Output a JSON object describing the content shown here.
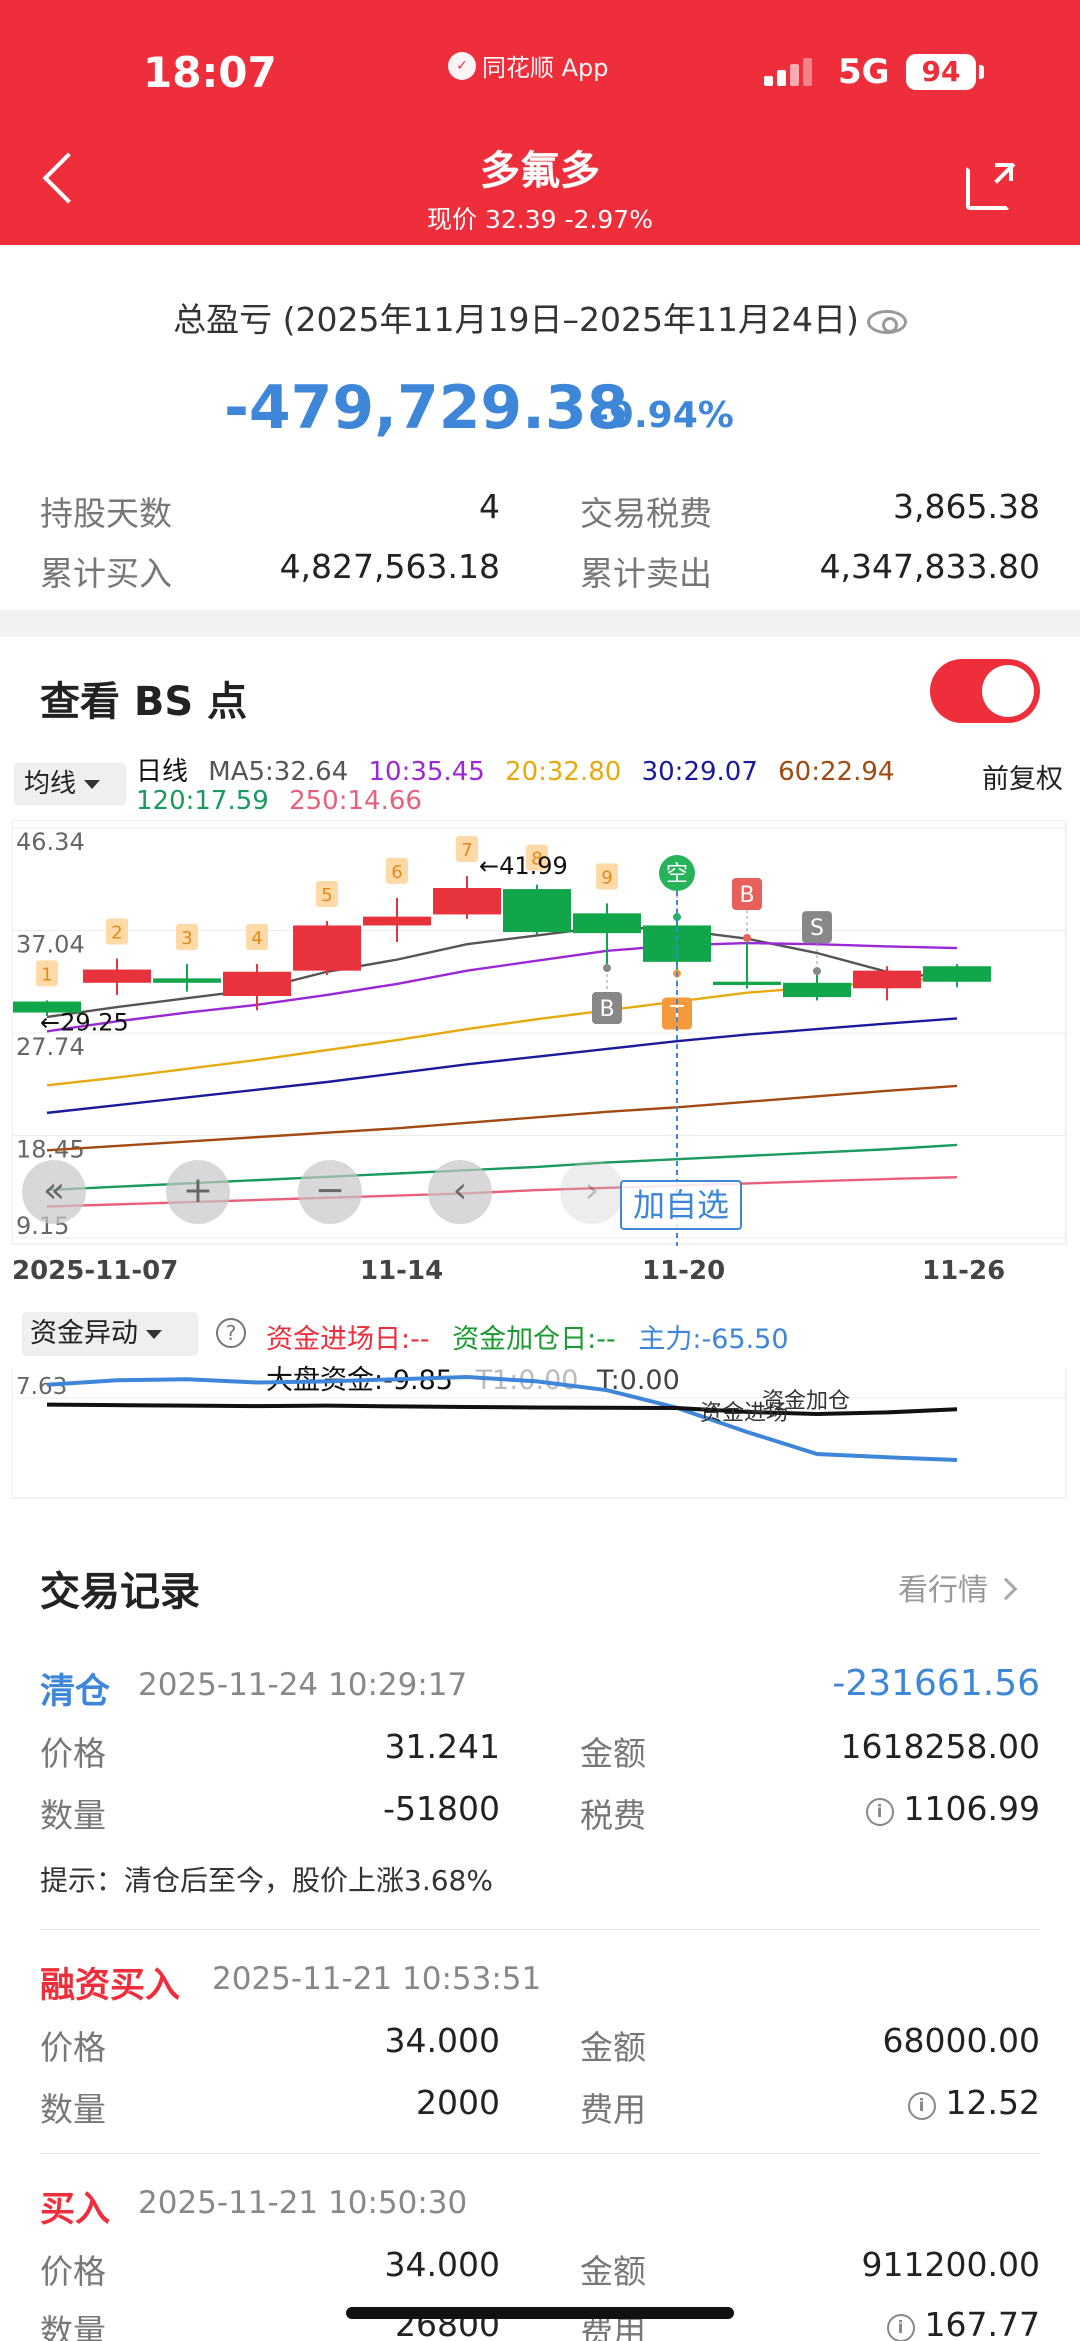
{
  "status": {
    "time": "18:07",
    "app": "同花顺 App",
    "network": "5G",
    "battery": "94"
  },
  "nav": {
    "title": "多氟多",
    "subtitle": "现价 32.39 -2.97%"
  },
  "summary": {
    "title": "总盈亏 (2025年11月19日–2025年11月24日)",
    "amount": "-479,729.38",
    "percent": "-9.94%",
    "stats": [
      {
        "label": "持股天数",
        "value": "4"
      },
      {
        "label": "交易税费",
        "value": "3,865.38"
      },
      {
        "label": "累计买入",
        "value": "4,827,563.18"
      },
      {
        "label": "累计卖出",
        "value": "4,347,833.80"
      }
    ]
  },
  "bs": {
    "title": "查看 BS 点",
    "toggle_on": true
  },
  "chart_data": {
    "type": "candlestick",
    "ma_select": "均线",
    "period": "日线",
    "adjust": "前复权",
    "ma_legend": [
      {
        "text": "MA5:32.64",
        "color": "#555555"
      },
      {
        "text": "10:35.45",
        "color": "#9b27d6"
      },
      {
        "text": "20:32.80",
        "color": "#e8a90f"
      },
      {
        "text": "30:29.07",
        "color": "#1a1a9c"
      },
      {
        "text": "60:22.94",
        "color": "#a14a12"
      },
      {
        "text": "120:17.59",
        "color": "#1a9a60"
      },
      {
        "text": "250:14.66",
        "color": "#e8607c"
      }
    ],
    "y_ticks": [
      "46.34",
      "37.04",
      "27.74",
      "18.45",
      "9.15"
    ],
    "ylim": [
      9.15,
      46.34
    ],
    "x_ticks": [
      "2025-11-07",
      "11-14",
      "11-20",
      "11-26"
    ],
    "max_label": "41.99",
    "min_label": "29.25",
    "candles": [
      {
        "o": 30.6,
        "c": 29.6,
        "h": 30.7,
        "l": 29.3,
        "n": "1"
      },
      {
        "o": 32.3,
        "c": 33.5,
        "h": 34.5,
        "l": 31.2,
        "n": "2"
      },
      {
        "o": 32.7,
        "c": 32.3,
        "h": 34.0,
        "l": 31.5,
        "n": "3"
      },
      {
        "o": 31.1,
        "c": 33.3,
        "h": 34.0,
        "l": 29.8,
        "n": "4"
      },
      {
        "o": 33.4,
        "c": 37.5,
        "h": 37.9,
        "l": 33.0,
        "n": "5"
      },
      {
        "o": 37.5,
        "c": 38.3,
        "h": 40.0,
        "l": 36.0,
        "n": "6"
      },
      {
        "o": 38.5,
        "c": 40.9,
        "h": 41.99,
        "l": 38.1,
        "n": "7"
      },
      {
        "o": 40.8,
        "c": 36.9,
        "h": 41.2,
        "l": 36.7,
        "n": "8"
      },
      {
        "o": 38.6,
        "c": 36.8,
        "h": 39.5,
        "l": 34.0,
        "n": "9"
      },
      {
        "o": 37.5,
        "c": 34.2,
        "h": 37.9,
        "l": 33.5,
        "n": ""
      },
      {
        "o": 32.4,
        "c": 32.1,
        "h": 36.0,
        "l": 31.8,
        "n": ""
      },
      {
        "o": 32.3,
        "c": 31.0,
        "h": 33.0,
        "l": 30.7,
        "n": ""
      },
      {
        "o": 31.8,
        "c": 33.4,
        "h": 33.8,
        "l": 30.7,
        "n": ""
      },
      {
        "o": 33.8,
        "c": 32.39,
        "h": 34.0,
        "l": 31.9,
        "n": ""
      }
    ],
    "signals": [
      {
        "i": 8,
        "label": "B",
        "pos": "below"
      },
      {
        "i": 9,
        "label": "空",
        "pos": "above"
      },
      {
        "i": 9,
        "label": "T",
        "pos": "below"
      },
      {
        "i": 10,
        "label": "B",
        "pos": "above"
      },
      {
        "i": 11,
        "label": "S",
        "pos": "above"
      }
    ],
    "ma_lines": [
      {
        "name": "MA5",
        "color": "#555555",
        "values": [
          29.2,
          30.1,
          30.9,
          31.7,
          33.3,
          34.4,
          35.8,
          36.6,
          37.4,
          37.1,
          36.3,
          35.0,
          33.3,
          32.64
        ]
      },
      {
        "name": "10",
        "color": "#9b27d6",
        "values": [
          27.9,
          28.8,
          29.6,
          30.3,
          31.2,
          32.2,
          33.4,
          34.3,
          35.2,
          35.7,
          35.9,
          35.8,
          35.6,
          35.45
        ]
      },
      {
        "name": "20",
        "color": "#e8a90f",
        "values": [
          23.0,
          23.7,
          24.5,
          25.3,
          26.2,
          27.1,
          28.1,
          29.0,
          29.8,
          30.6,
          31.4,
          31.9,
          32.4,
          32.8
        ]
      },
      {
        "name": "30",
        "color": "#1a1a9c",
        "values": [
          20.5,
          21.2,
          21.9,
          22.6,
          23.3,
          24.1,
          24.9,
          25.6,
          26.3,
          27.0,
          27.6,
          28.1,
          28.6,
          29.07
        ]
      },
      {
        "name": "60",
        "color": "#a14a12",
        "values": [
          17.1,
          17.5,
          17.9,
          18.3,
          18.7,
          19.1,
          19.6,
          20.1,
          20.6,
          21.0,
          21.5,
          22.0,
          22.5,
          22.94
        ]
      },
      {
        "name": "120",
        "color": "#1a9a60",
        "values": [
          13.5,
          13.8,
          14.1,
          14.4,
          14.7,
          15.0,
          15.3,
          15.6,
          16.0,
          16.3,
          16.6,
          16.9,
          17.2,
          17.59
        ]
      },
      {
        "name": "250",
        "color": "#e8607c",
        "values": [
          12.0,
          12.2,
          12.4,
          12.6,
          12.8,
          13.0,
          13.2,
          13.5,
          13.7,
          13.9,
          14.1,
          14.3,
          14.5,
          14.66
        ]
      }
    ]
  },
  "controls": {
    "prev_all": "«",
    "zoom_in": "+",
    "zoom_out": "−",
    "prev": "‹",
    "next": "›",
    "add_watch": "加自选"
  },
  "fund": {
    "select": "资金异动",
    "entry": "资金进场日:--",
    "add": "资金加仓日:--",
    "main": "主力:-65.50",
    "market": "大盘资金:-9.85",
    "t1": "T1:0.00",
    "t0": "T:0.00",
    "y_tick": "7.63",
    "label_entry": "资金进场",
    "label_add": "资金加仓",
    "main_values": [
      3,
      7,
      8,
      5,
      6,
      8,
      10,
      6,
      -2,
      -18,
      -40,
      -60,
      -63,
      -65.5
    ],
    "market_values": [
      -1,
      -1.2,
      -1.4,
      -1.6,
      -1.4,
      -1.7,
      -1.9,
      -2.1,
      -2.2,
      -2.3,
      -3.8,
      -4.6,
      -4.0,
      -2.8
    ]
  },
  "records": {
    "title": "交易记录",
    "more": "看行情",
    "items": [
      {
        "type": "清仓",
        "type_color": "#3d86d8",
        "time": "2025-11-24 10:29:17",
        "pnl": "-231661.56",
        "price_label": "价格",
        "price": "31.241",
        "amount_label": "金额",
        "amount": "1618258.00",
        "qty_label": "数量",
        "qty": "-51800",
        "fee_label": "税费",
        "fee": "1106.99",
        "tip": "提示：清仓后至今，股价上涨3.68%"
      },
      {
        "type": "融资买入",
        "type_color": "#ee2f3b",
        "time": "2025-11-21 10:53:51",
        "price_label": "价格",
        "price": "34.000",
        "amount_label": "金额",
        "amount": "68000.00",
        "qty_label": "数量",
        "qty": "2000",
        "fee_label": "费用",
        "fee": "12.52"
      },
      {
        "type": "买入",
        "type_color": "#ee2f3b",
        "time": "2025-11-21 10:50:30",
        "price_label": "价格",
        "price": "34.000",
        "amount_label": "金额",
        "amount": "911200.00",
        "qty_label": "数量",
        "qty": "26800",
        "fee_label": "费用",
        "fee": "167.77"
      }
    ]
  }
}
